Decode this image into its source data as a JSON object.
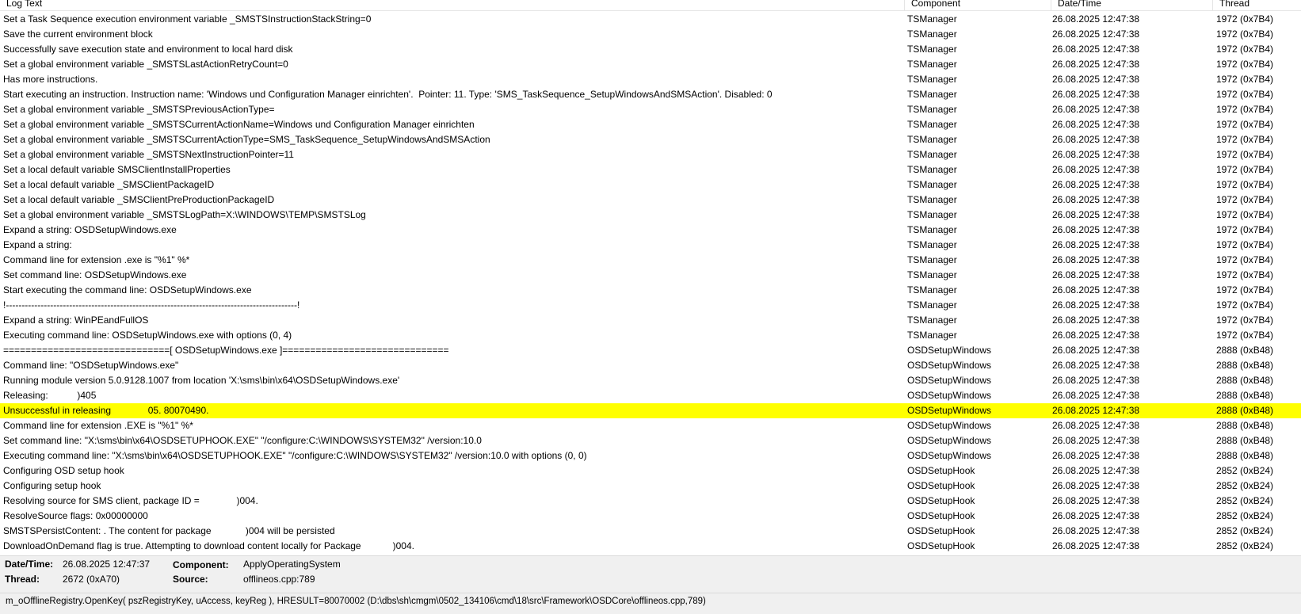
{
  "columns": {
    "log_text": "Log Text",
    "component": "Component",
    "datetime": "Date/Time",
    "thread": "Thread"
  },
  "rows": [
    {
      "text": "Set a Task Sequence execution environment variable _SMSTSInstructionStackString=0",
      "component": "TSManager",
      "datetime": "26.08.2025 12:47:38",
      "thread": "1972 (0x7B4)"
    },
    {
      "text": "Save the current environment block",
      "component": "TSManager",
      "datetime": "26.08.2025 12:47:38",
      "thread": "1972 (0x7B4)"
    },
    {
      "text": "Successfully save execution state and environment to local hard disk",
      "component": "TSManager",
      "datetime": "26.08.2025 12:47:38",
      "thread": "1972 (0x7B4)"
    },
    {
      "text": "Set a global environment variable _SMSTSLastActionRetryCount=0",
      "component": "TSManager",
      "datetime": "26.08.2025 12:47:38",
      "thread": "1972 (0x7B4)"
    },
    {
      "text": "Has more instructions.",
      "component": "TSManager",
      "datetime": "26.08.2025 12:47:38",
      "thread": "1972 (0x7B4)"
    },
    {
      "text": "Start executing an instruction. Instruction name: 'Windows und Configuration Manager einrichten'.  Pointer: 11. Type: 'SMS_TaskSequence_SetupWindowsAndSMSAction'. Disabled: 0",
      "component": "TSManager",
      "datetime": "26.08.2025 12:47:38",
      "thread": "1972 (0x7B4)"
    },
    {
      "text": "Set a global environment variable _SMSTSPreviousActionType=",
      "component": "TSManager",
      "datetime": "26.08.2025 12:47:38",
      "thread": "1972 (0x7B4)"
    },
    {
      "text": "Set a global environment variable _SMSTSCurrentActionName=Windows und Configuration Manager einrichten",
      "component": "TSManager",
      "datetime": "26.08.2025 12:47:38",
      "thread": "1972 (0x7B4)"
    },
    {
      "text": "Set a global environment variable _SMSTSCurrentActionType=SMS_TaskSequence_SetupWindowsAndSMSAction",
      "component": "TSManager",
      "datetime": "26.08.2025 12:47:38",
      "thread": "1972 (0x7B4)"
    },
    {
      "text": "Set a global environment variable _SMSTSNextInstructionPointer=11",
      "component": "TSManager",
      "datetime": "26.08.2025 12:47:38",
      "thread": "1972 (0x7B4)"
    },
    {
      "text": "Set a local default variable SMSClientInstallProperties",
      "component": "TSManager",
      "datetime": "26.08.2025 12:47:38",
      "thread": "1972 (0x7B4)"
    },
    {
      "text": "Set a local default variable _SMSClientPackageID",
      "component": "TSManager",
      "datetime": "26.08.2025 12:47:38",
      "thread": "1972 (0x7B4)"
    },
    {
      "text": "Set a local default variable _SMSClientPreProductionPackageID",
      "component": "TSManager",
      "datetime": "26.08.2025 12:47:38",
      "thread": "1972 (0x7B4)"
    },
    {
      "text": "Set a global environment variable _SMSTSLogPath=X:\\WINDOWS\\TEMP\\SMSTSLog",
      "component": "TSManager",
      "datetime": "26.08.2025 12:47:38",
      "thread": "1972 (0x7B4)"
    },
    {
      "text": "Expand a string: OSDSetupWindows.exe",
      "component": "TSManager",
      "datetime": "26.08.2025 12:47:38",
      "thread": "1972 (0x7B4)"
    },
    {
      "text": "Expand a string:",
      "component": "TSManager",
      "datetime": "26.08.2025 12:47:38",
      "thread": "1972 (0x7B4)"
    },
    {
      "text": "Command line for extension .exe is \"%1\" %*",
      "component": "TSManager",
      "datetime": "26.08.2025 12:47:38",
      "thread": "1972 (0x7B4)"
    },
    {
      "text": "Set command line: OSDSetupWindows.exe",
      "component": "TSManager",
      "datetime": "26.08.2025 12:47:38",
      "thread": "1972 (0x7B4)"
    },
    {
      "text": "Start executing the command line: OSDSetupWindows.exe",
      "component": "TSManager",
      "datetime": "26.08.2025 12:47:38",
      "thread": "1972 (0x7B4)"
    },
    {
      "text": "!--------------------------------------------------------------------------------------------!",
      "component": "TSManager",
      "datetime": "26.08.2025 12:47:38",
      "thread": "1972 (0x7B4)"
    },
    {
      "text": "Expand a string: WinPEandFullOS",
      "component": "TSManager",
      "datetime": "26.08.2025 12:47:38",
      "thread": "1972 (0x7B4)"
    },
    {
      "text": "Executing command line: OSDSetupWindows.exe with options (0, 4)",
      "component": "TSManager",
      "datetime": "26.08.2025 12:47:38",
      "thread": "1972 (0x7B4)"
    },
    {
      "text": "==============================[ OSDSetupWindows.exe ]==============================",
      "component": "OSDSetupWindows",
      "datetime": "26.08.2025 12:47:38",
      "thread": "2888 (0xB48)"
    },
    {
      "text": "Command line: \"OSDSetupWindows.exe\"",
      "component": "OSDSetupWindows",
      "datetime": "26.08.2025 12:47:38",
      "thread": "2888 (0xB48)"
    },
    {
      "text": "Running module version 5.0.9128.1007 from location 'X:\\sms\\bin\\x64\\OSDSetupWindows.exe'",
      "component": "OSDSetupWindows",
      "datetime": "26.08.2025 12:47:38",
      "thread": "2888 (0xB48)"
    },
    {
      "text": "Releasing:           )405",
      "component": "OSDSetupWindows",
      "datetime": "26.08.2025 12:47:38",
      "thread": "2888 (0xB48)"
    },
    {
      "text": "Unsuccessful in releasing              05. 80070490.",
      "component": "OSDSetupWindows",
      "datetime": "26.08.2025 12:47:38",
      "thread": "2888 (0xB48)",
      "highlight": true
    },
    {
      "text": "Command line for extension .EXE is \"%1\" %*",
      "component": "OSDSetupWindows",
      "datetime": "26.08.2025 12:47:38",
      "thread": "2888 (0xB48)"
    },
    {
      "text": "Set command line: \"X:\\sms\\bin\\x64\\OSDSETUPHOOK.EXE\" \"/configure:C:\\WINDOWS\\SYSTEM32\" /version:10.0",
      "component": "OSDSetupWindows",
      "datetime": "26.08.2025 12:47:38",
      "thread": "2888 (0xB48)"
    },
    {
      "text": "Executing command line: \"X:\\sms\\bin\\x64\\OSDSETUPHOOK.EXE\" \"/configure:C:\\WINDOWS\\SYSTEM32\" /version:10.0 with options (0, 0)",
      "component": "OSDSetupWindows",
      "datetime": "26.08.2025 12:47:38",
      "thread": "2888 (0xB48)"
    },
    {
      "text": "Configuring OSD setup hook",
      "component": "OSDSetupHook",
      "datetime": "26.08.2025 12:47:38",
      "thread": "2852 (0xB24)"
    },
    {
      "text": "Configuring setup hook",
      "component": "OSDSetupHook",
      "datetime": "26.08.2025 12:47:38",
      "thread": "2852 (0xB24)"
    },
    {
      "text": "Resolving source for SMS client, package ID =              )004.",
      "component": "OSDSetupHook",
      "datetime": "26.08.2025 12:47:38",
      "thread": "2852 (0xB24)"
    },
    {
      "text": "ResolveSource flags: 0x00000000",
      "component": "OSDSetupHook",
      "datetime": "26.08.2025 12:47:38",
      "thread": "2852 (0xB24)"
    },
    {
      "text": "SMSTSPersistContent: . The content for package             )004 will be persisted",
      "component": "OSDSetupHook",
      "datetime": "26.08.2025 12:47:38",
      "thread": "2852 (0xB24)"
    },
    {
      "text": "DownloadOnDemand flag is true. Attempting to download content locally for Package            )004.",
      "component": "OSDSetupHook",
      "datetime": "26.08.2025 12:47:38",
      "thread": "2852 (0xB24)"
    }
  ],
  "detail": {
    "datetime_label": "Date/Time:",
    "datetime_value": "26.08.2025 12:47:37",
    "component_label": "Component:",
    "component_value": "ApplyOperatingSystem",
    "thread_label": "Thread:",
    "thread_value": "2672 (0xA70)",
    "source_label": "Source:",
    "source_value": "offlineos.cpp:789"
  },
  "message": "m_oOfflineRegistry.OpenKey( pszRegistryKey, uAccess, keyReg ), HRESULT=80070002 (D:\\dbs\\sh\\cmgm\\0502_134106\\cmd\\18\\src\\Framework\\OSDCore\\offlineos.cpp,789)",
  "colors": {
    "highlight": "#ffff00",
    "pane_background": "#f0f0f0"
  }
}
